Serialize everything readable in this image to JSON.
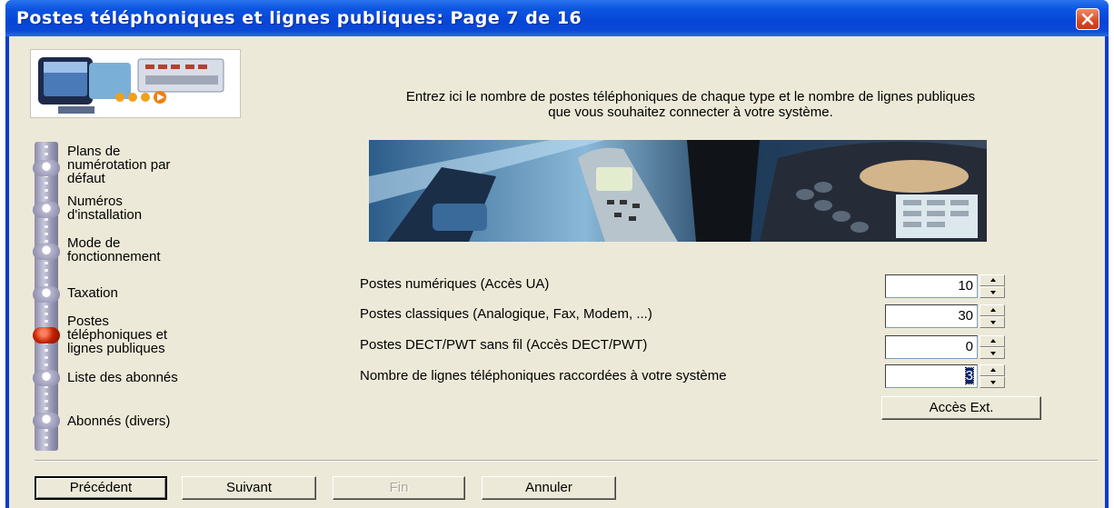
{
  "window": {
    "title": "Postes téléphoniques et lignes publiques:  Page 7 de 16"
  },
  "intro": {
    "line1": "Entrez ici le nombre de postes téléphoniques de chaque type et le nombre de lignes publiques",
    "line2": "que vous souhaitez connecter à votre système."
  },
  "steps": [
    {
      "label_lines": [
        "Plans de",
        "numérotation par",
        "défaut"
      ],
      "active": false
    },
    {
      "label_lines": [
        "Numéros",
        "d'installation"
      ],
      "active": false
    },
    {
      "label_lines": [
        "Mode de",
        "fonctionnement"
      ],
      "active": false
    },
    {
      "label_lines": [
        "Taxation"
      ],
      "active": false
    },
    {
      "label_lines": [
        "Postes",
        "téléphoniques et",
        "lignes publiques"
      ],
      "active": true
    },
    {
      "label_lines": [
        "Liste des abonnés"
      ],
      "active": false
    },
    {
      "label_lines": [
        "Abonnés (divers)"
      ],
      "active": false
    }
  ],
  "fields": [
    {
      "label": "Postes numériques (Accès UA)",
      "value": "10"
    },
    {
      "label": "Postes classiques (Analogique, Fax, Modem, ...)",
      "value": "30"
    },
    {
      "label": "Postes DECT/PWT sans fil (Accès DECT/PWT)",
      "value": "0"
    },
    {
      "label": "Nombre de lignes téléphoniques raccordées à votre système",
      "value": "3"
    }
  ],
  "buttons": {
    "acces_ext": "Accès Ext.",
    "precedent": "Précédent",
    "suivant": "Suivant",
    "fin": "Fin",
    "annuler": "Annuler"
  },
  "colors": {
    "titlebar": "#0645d6",
    "dialog": "#ece9d8",
    "close": "#d94a22",
    "active_step": "#c02000"
  },
  "icons": {
    "close": "close-icon",
    "logo": "telephony-logo-image",
    "banner": "phones-banner-image"
  }
}
